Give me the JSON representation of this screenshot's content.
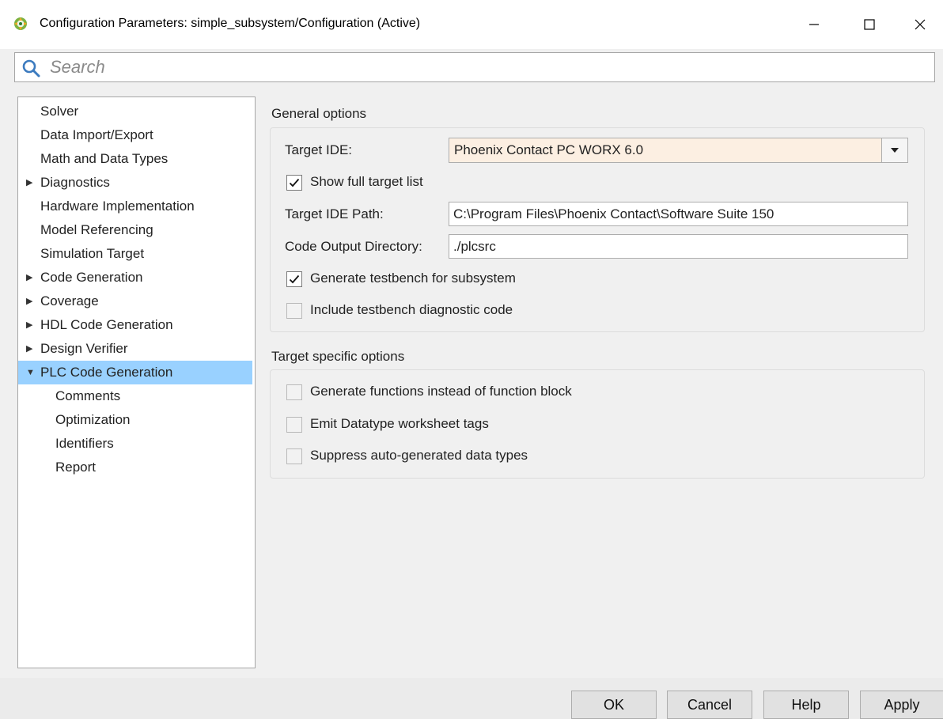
{
  "window": {
    "title": "Configuration Parameters: simple_subsystem/Configuration (Active)",
    "minimize_glyph": "—",
    "close_glyph": "✕"
  },
  "search": {
    "placeholder": "Search",
    "value": ""
  },
  "tree": {
    "items": [
      {
        "label": "Solver",
        "arrow": ""
      },
      {
        "label": "Data Import/Export",
        "arrow": ""
      },
      {
        "label": "Math and Data Types",
        "arrow": ""
      },
      {
        "label": "Diagnostics",
        "arrow": "▶"
      },
      {
        "label": "Hardware Implementation",
        "arrow": ""
      },
      {
        "label": "Model Referencing",
        "arrow": ""
      },
      {
        "label": "Simulation Target",
        "arrow": ""
      },
      {
        "label": "Code Generation",
        "arrow": "▶"
      },
      {
        "label": "Coverage",
        "arrow": "▶"
      },
      {
        "label": "HDL Code Generation",
        "arrow": "▶"
      },
      {
        "label": "Design Verifier",
        "arrow": "▶"
      },
      {
        "label": "PLC Code Generation",
        "arrow": "▼",
        "selected": true
      },
      {
        "label": "Comments",
        "arrow": ""
      },
      {
        "label": "Optimization",
        "arrow": ""
      },
      {
        "label": "Identifiers",
        "arrow": ""
      },
      {
        "label": "Report",
        "arrow": ""
      }
    ]
  },
  "general": {
    "title": "General options",
    "target_ide_label": "Target IDE:",
    "target_ide_value": "Phoenix Contact PC WORX 6.0",
    "show_full_label": "Show full target list",
    "show_full_checked": true,
    "target_path_label": "Target IDE Path:",
    "target_path_value": "C:\\Program Files\\Phoenix Contact\\Software Suite 150",
    "output_dir_label": "Code Output Directory:",
    "output_dir_value": "./plcsrc",
    "gen_testbench_label": "Generate testbench for subsystem",
    "gen_testbench_checked": true,
    "include_diag_label": "Include testbench diagnostic code",
    "include_diag_checked": false
  },
  "target_specific": {
    "title": "Target specific options",
    "opt1_label": "Generate functions instead of function block",
    "opt2_label": "Emit Datatype worksheet tags",
    "opt3_label": "Suppress auto-generated data types"
  },
  "buttons": {
    "ok": "OK",
    "cancel": "Cancel",
    "help": "Help",
    "apply": "Apply"
  },
  "colors": {
    "selection": "#99d1ff",
    "combo_bg": "#fcefe2",
    "accent_icon": "#3c7bbf"
  }
}
